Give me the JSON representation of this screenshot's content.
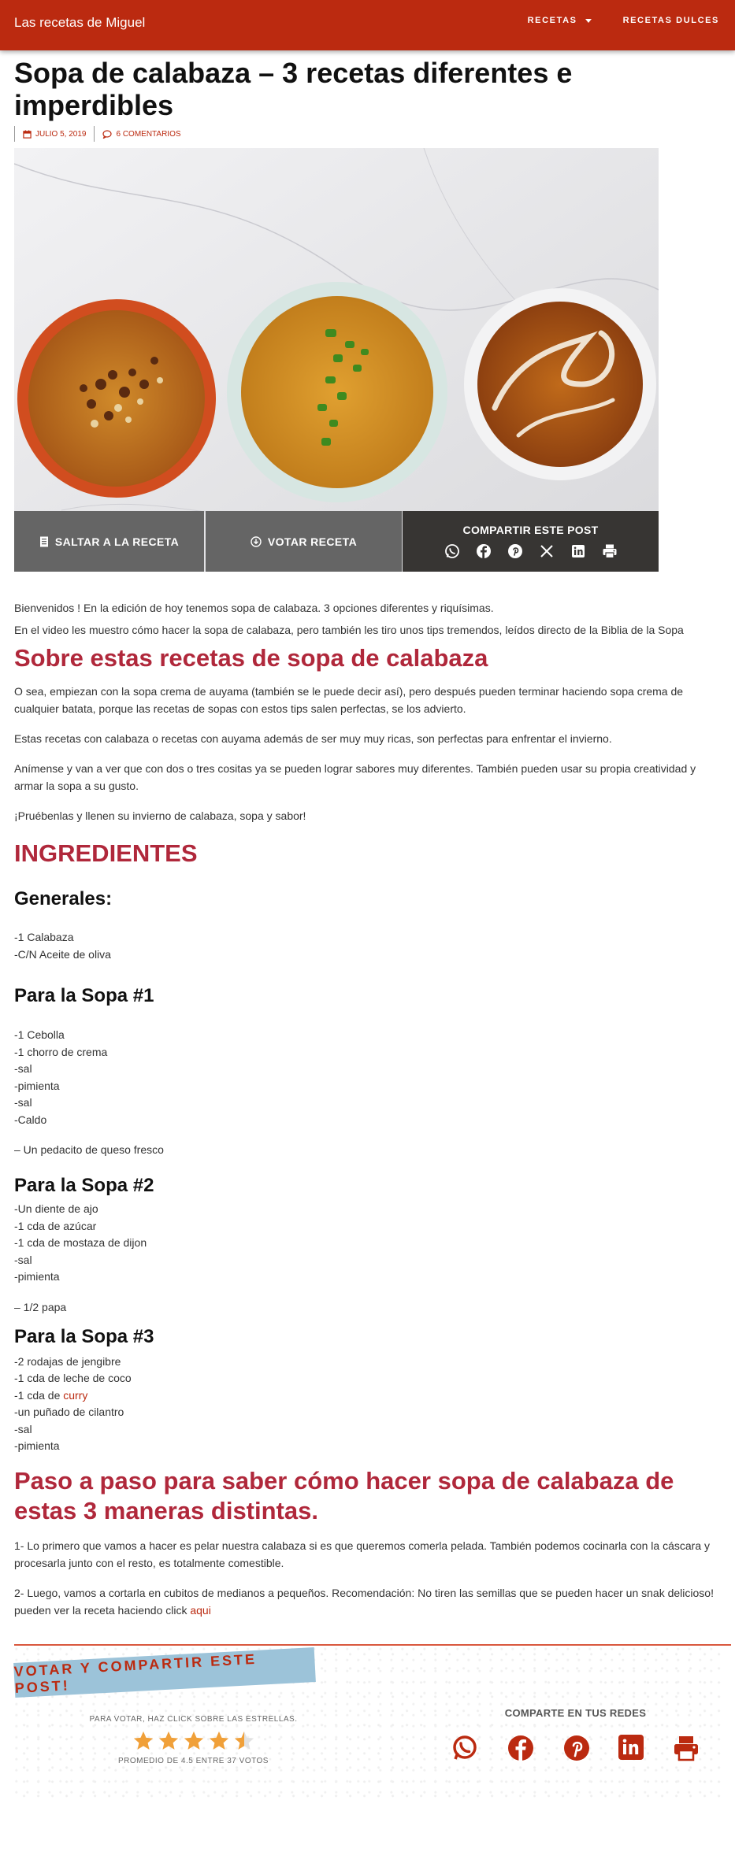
{
  "header": {
    "brand": "Las recetas de Miguel",
    "nav": [
      {
        "label": "RECETAS"
      },
      {
        "label": "RECETAS DULCES"
      }
    ]
  },
  "post": {
    "title": "Sopa de calabaza – 3 recetas diferentes e imperdibles",
    "date": "JULIO 5, 2019",
    "comments": "6 COMENTARIOS"
  },
  "actions": {
    "jump_label": "SALTAR A LA RECETA",
    "vote_label": "VOTAR RECETA",
    "share_title": "COMPARTIR ESTE POST",
    "share_icons": [
      "whatsapp-icon",
      "facebook-icon",
      "pinterest-icon",
      "x-icon",
      "linkedin-icon",
      "print-icon"
    ]
  },
  "intro": {
    "p1": "Bienvenidos ! En la edición de hoy tenemos sopa de calabaza. 3 opciones diferentes y riquísimas.",
    "p2": "En el video les muestro cómo hacer la sopa de calabaza, pero también les tiro unos tips tremendos, leídos directo de la Biblia de la Sopa"
  },
  "about": {
    "heading": "Sobre estas recetas de sopa de calabaza",
    "paragraphs": [
      "O sea, empiezan con la sopa crema de auyama (también se le puede decir así), pero después pueden terminar haciendo sopa crema de cualquier batata, porque las recetas de sopas con estos tips salen perfectas, se los advierto.",
      "Estas recetas con calabaza o recetas con auyama además de ser muy muy ricas, son perfectas para enfrentar el invierno.",
      "Anímense y van a ver que con dos o tres cositas ya se pueden lograr sabores muy diferentes. También pueden usar su propia creatividad y armar la sopa a su gusto.",
      "¡Pruébenlas y llenen su invierno de calabaza, sopa y sabor!"
    ]
  },
  "ingredients": {
    "heading": "INGREDIENTES",
    "general_title": "Generales:",
    "general": [
      "-1 Calabaza",
      "-C/N Aceite de oliva"
    ],
    "sopa1_title": "Para la Sopa #1",
    "sopa1": [
      "-1 Cebolla",
      "-1 chorro de crema",
      "-sal",
      "-pimienta",
      "-sal",
      "-Caldo"
    ],
    "sopa1_extra": "– Un pedacito de queso fresco",
    "sopa2_title": "Para la Sopa #2",
    "sopa2": [
      "-Un diente de ajo",
      "-1 cda de azúcar",
      "-1 cda de mostaza de dijon",
      "-sal",
      "-pimienta"
    ],
    "sopa2_extra": "– 1/2 papa",
    "sopa3_title": "Para la Sopa #3",
    "sopa3": [
      "-2 rodajas de jengibre",
      "-1 cda de leche de coco"
    ],
    "sopa3_curry_prefix": "-1 cda de ",
    "sopa3_curry_link": "curry",
    "sopa3_rest": [
      "-un puñado de cilantro",
      "-sal",
      "-pimienta"
    ]
  },
  "steps": {
    "heading": "Paso a paso para saber cómo hacer sopa de calabaza de estas 3 maneras distintas.",
    "step1": "1- Lo primero que vamos a hacer es pelar nuestra calabaza si es que queremos comerla pelada. También podemos cocinarla con la cáscara y procesarla junto con el resto, es totalmente comestible.",
    "step2": "2- Luego, vamos a cortarla en cubitos de medianos a pequeños. Recomendación: No tiren las semillas que se pueden hacer un snak delicioso! pueden ver la receta haciendo click ",
    "step2_link": "aqui"
  },
  "vote": {
    "banner": "VOTAR Y COMPARTIR ESTE POST!",
    "hint": "PARA VOTAR, HAZ CLICK SOBRE LAS ESTRELLAS.",
    "rating": 4.5,
    "rating_max": 5,
    "average_text": "PROMEDIO DE 4.5 ENTRE 37 VOTOS",
    "share_title": "COMPARTE EN TUS REDES",
    "net_icons": [
      "whatsapp-icon",
      "facebook-icon",
      "pinterest-icon",
      "linkedin-icon",
      "print-icon"
    ]
  },
  "colors": {
    "brand": "#bb2a10",
    "heading": "#b0283b",
    "star": "#f0a039",
    "banner": "#9cc3d9"
  }
}
